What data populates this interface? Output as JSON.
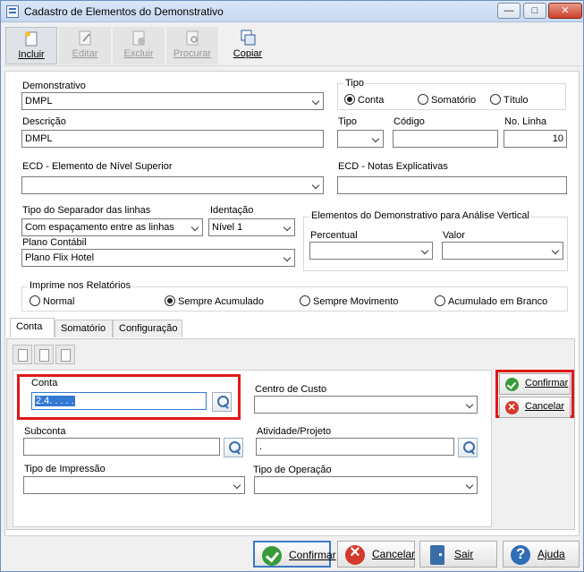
{
  "window": {
    "title": "Cadastro de Elementos do Demonstrativo"
  },
  "window_controls": {
    "minimize": "—",
    "maximize": "□",
    "close": "✕"
  },
  "toolbar": {
    "incluir": "Incluir",
    "editar": "Editar",
    "excluir": "Excluir",
    "procurar": "Procurar",
    "copiar": "Copiar"
  },
  "form": {
    "demonstrativo_label": "Demonstrativo",
    "demonstrativo_value": "DMPL",
    "tipo_group_label": "Tipo",
    "tipo_options": [
      "Conta",
      "Somatório",
      "Título"
    ],
    "descricao_label": "Descrição",
    "descricao_value": "DMPL",
    "tipo_label": "Tipo",
    "tipo_value": "",
    "codigo_label": "Código",
    "codigo_value": "",
    "no_linha_label": "No. Linha",
    "no_linha_value": "10",
    "ecd_elemento_label": "ECD - Elemento de Nível Superior",
    "ecd_elemento_value": "",
    "ecd_notas_label": "ECD - Notas Explicativas",
    "ecd_notas_value": "",
    "separador_label": "Tipo do Separador das linhas",
    "separador_value": "Com espaçamento entre as linhas",
    "identacao_label": "Identação",
    "identacao_value": "Nível 1",
    "plano_label": "Plano Contábil",
    "plano_value": "Plano Flix Hotel",
    "analise_group_label": "Elementos do Demonstrativo para Análise Vertical",
    "percentual_label": "Percentual",
    "percentual_value": "",
    "valor_label": "Valor",
    "valor_value": "",
    "imprime_group_label": "Imprime nos Relatórios",
    "imprime_options": [
      "Normal",
      "Sempre Acumulado",
      "Sempre Movimento",
      "Acumulado em Branco"
    ]
  },
  "tabs": [
    "Conta",
    "Somatório",
    "Configuração"
  ],
  "conta_tab": {
    "conta_label": "Conta",
    "conta_value": "2.4. . . . .",
    "centro_custo_label": "Centro de Custo",
    "centro_custo_value": "",
    "subconta_label": "Subconta",
    "subconta_value": "",
    "atividade_label": "Atividade/Projeto",
    "atividade_value": ".",
    "tipo_impressao_label": "Tipo de Impressão",
    "tipo_impressao_value": "",
    "tipo_operacao_label": "Tipo de Operação",
    "tipo_operacao_value": "",
    "confirmar": "Confirmar",
    "cancelar": "Cancelar"
  },
  "footer": {
    "confirmar": "Confirmar",
    "cancelar": "Cancelar",
    "sair": "Sair",
    "ajuda": "Ajuda"
  },
  "colors": {
    "highlight_red": "#e01818",
    "selection_blue": "#3278d4"
  }
}
